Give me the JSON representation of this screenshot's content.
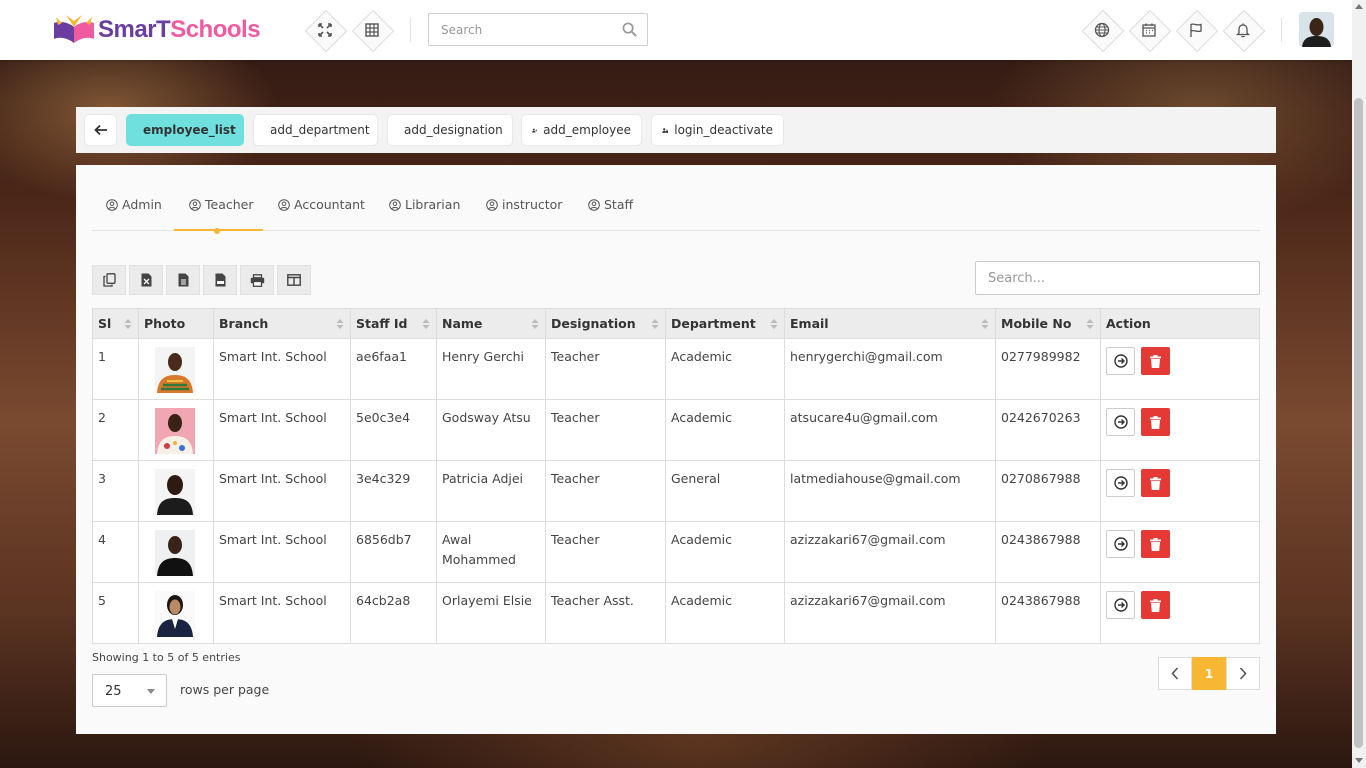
{
  "header": {
    "logo_part1": "SmarT",
    "logo_part2": "Schools",
    "search_placeholder": "Search",
    "icons": [
      "fullscreen-icon",
      "grid-icon",
      "globe-icon",
      "calendar-icon",
      "flag-icon",
      "bell-icon"
    ]
  },
  "tabbar": {
    "back_icon": "arrow-left-icon",
    "buttons": [
      {
        "label": "employee_list",
        "icon": "users-icon",
        "active": true
      },
      {
        "label": "add_department",
        "icon": "building-icon",
        "active": false
      },
      {
        "label": "add_designation",
        "icon": "id-card-icon",
        "active": false
      },
      {
        "label": "add_employee",
        "icon": "user-plus-icon",
        "active": false
      },
      {
        "label": "login_deactivate",
        "icon": "user-lock-icon",
        "active": false
      }
    ]
  },
  "role_tabs": [
    "Admin",
    "Teacher",
    "Accountant",
    "Librarian",
    "instructor",
    "Staff"
  ],
  "active_role": "Teacher",
  "table": {
    "search_placeholder": "Search...",
    "tools": [
      "copy-icon",
      "excel-icon",
      "csv-icon",
      "pdf-icon",
      "print-icon",
      "columns-icon"
    ],
    "columns": [
      "Sl",
      "Photo",
      "Branch",
      "Staff Id",
      "Name",
      "Designation",
      "Department",
      "Email",
      "Mobile No",
      "Action"
    ],
    "rows": [
      {
        "sl": "1",
        "branch": "Smart Int. School",
        "staff_id": "ae6faa1",
        "name": "Henry Gerchi",
        "designation": "Teacher",
        "department": "Academic",
        "email": "henrygerchi@gmail.com",
        "mobile": "0277989982"
      },
      {
        "sl": "2",
        "branch": "Smart Int. School",
        "staff_id": "5e0c3e4",
        "name": "Godsway Atsu",
        "designation": "Teacher",
        "department": "Academic",
        "email": "atsucare4u@gmail.com",
        "mobile": "0242670263"
      },
      {
        "sl": "3",
        "branch": "Smart Int. School",
        "staff_id": "3e4c329",
        "name": "Patricia Adjei",
        "designation": "Teacher",
        "department": "General",
        "email": "latmediahouse@gmail.com",
        "mobile": "0270867988"
      },
      {
        "sl": "4",
        "branch": "Smart Int. School",
        "staff_id": "6856db7",
        "name": "Awal Mohammed",
        "designation": "Teacher",
        "department": "Academic",
        "email": "azizzakari67@gmail.com",
        "mobile": "0243867988"
      },
      {
        "sl": "5",
        "branch": "Smart Int. School",
        "staff_id": "64cb2a8",
        "name": "Orlayemi Elsie",
        "designation": "Teacher Asst.",
        "department": "Academic",
        "email": "azizzakari67@gmail.com",
        "mobile": "0243867988"
      }
    ]
  },
  "footer": {
    "info": "Showing 1 to 5 of 5 entries",
    "rows_per_page_value": "25",
    "rows_per_page_label": "rows per page",
    "current_page": "1"
  },
  "colors": {
    "active_tab": "#6fe0de",
    "accent": "#f7b733",
    "delete": "#e53935"
  }
}
